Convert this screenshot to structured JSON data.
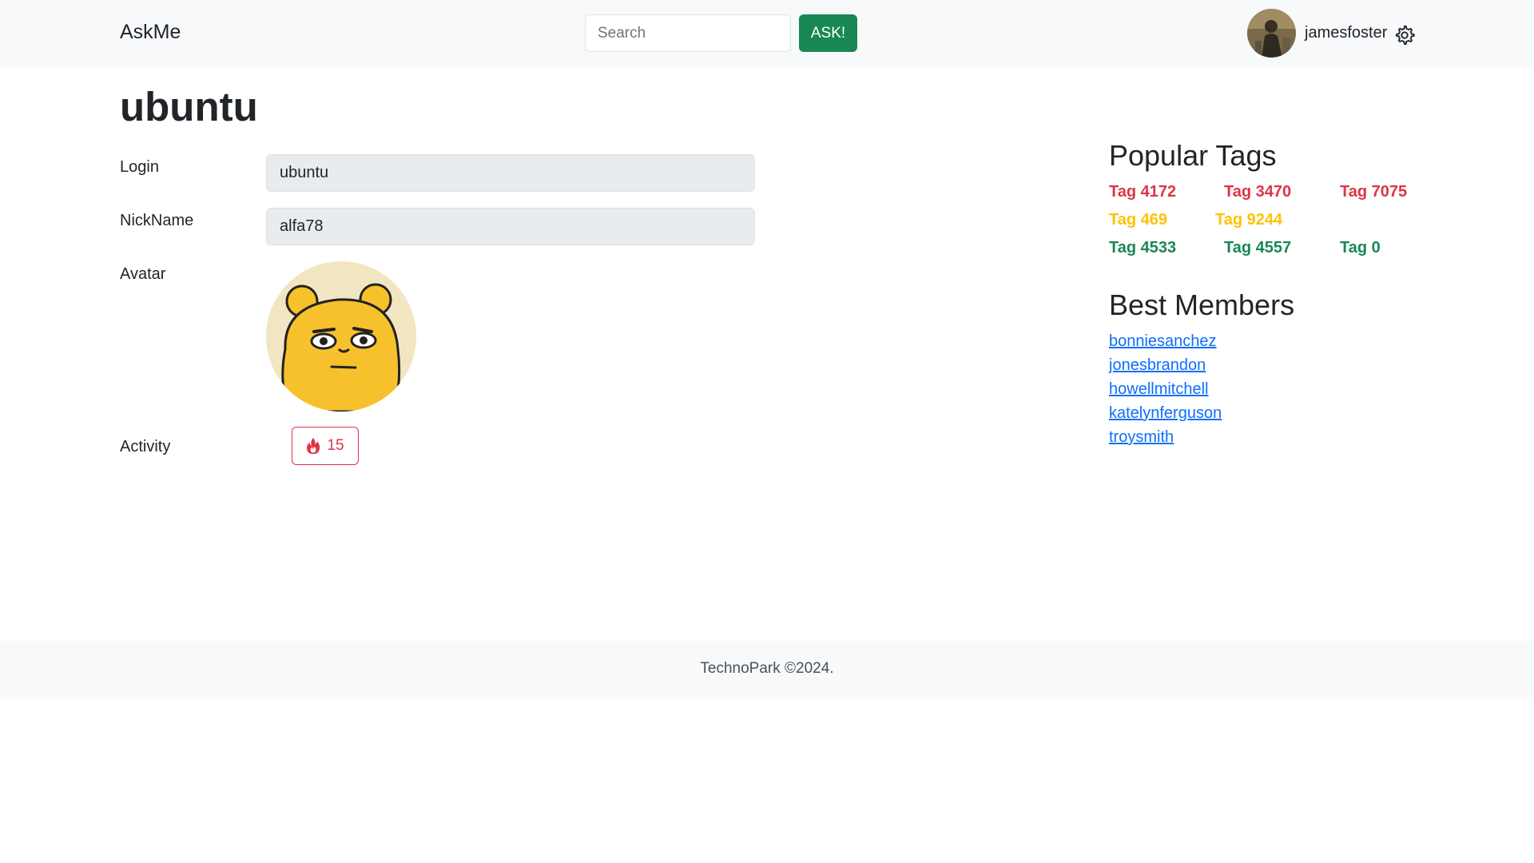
{
  "navbar": {
    "brand": "AskMe",
    "search_placeholder": "Search",
    "ask_label": "ASK!",
    "username": "jamesfoster"
  },
  "profile": {
    "title": "ubuntu",
    "login_label": "Login",
    "login_value": "ubuntu",
    "nickname_label": "NickName",
    "nickname_value": "alfa78",
    "avatar_label": "Avatar",
    "activity_label": "Activity",
    "activity_count": "15"
  },
  "sidebar": {
    "popular_tags_title": "Popular Tags",
    "tags": [
      {
        "label": "Tag 4172",
        "color": "#dc3545"
      },
      {
        "label": "Tag 3470",
        "color": "#dc3545"
      },
      {
        "label": "Tag 7075",
        "color": "#dc3545"
      },
      {
        "label": "Tag 469",
        "color": "#ffc107"
      },
      {
        "label": "Tag 9244",
        "color": "#ffc107"
      },
      {
        "label": "Tag 4533",
        "color": "#198754"
      },
      {
        "label": "Tag 4557",
        "color": "#198754"
      },
      {
        "label": "Tag 0",
        "color": "#198754"
      }
    ],
    "best_members_title": "Best Members",
    "members": [
      "bonniesanchez",
      "jonesbrandon",
      "howellmitchell",
      "katelynferguson",
      "troysmith"
    ]
  },
  "footer": {
    "text": "TechnoPark ©2024."
  },
  "colors": {
    "success": "#198754",
    "danger": "#dc3545",
    "warning": "#ffc107",
    "link": "#0d6efd",
    "light_bg": "#f8f9fa"
  }
}
